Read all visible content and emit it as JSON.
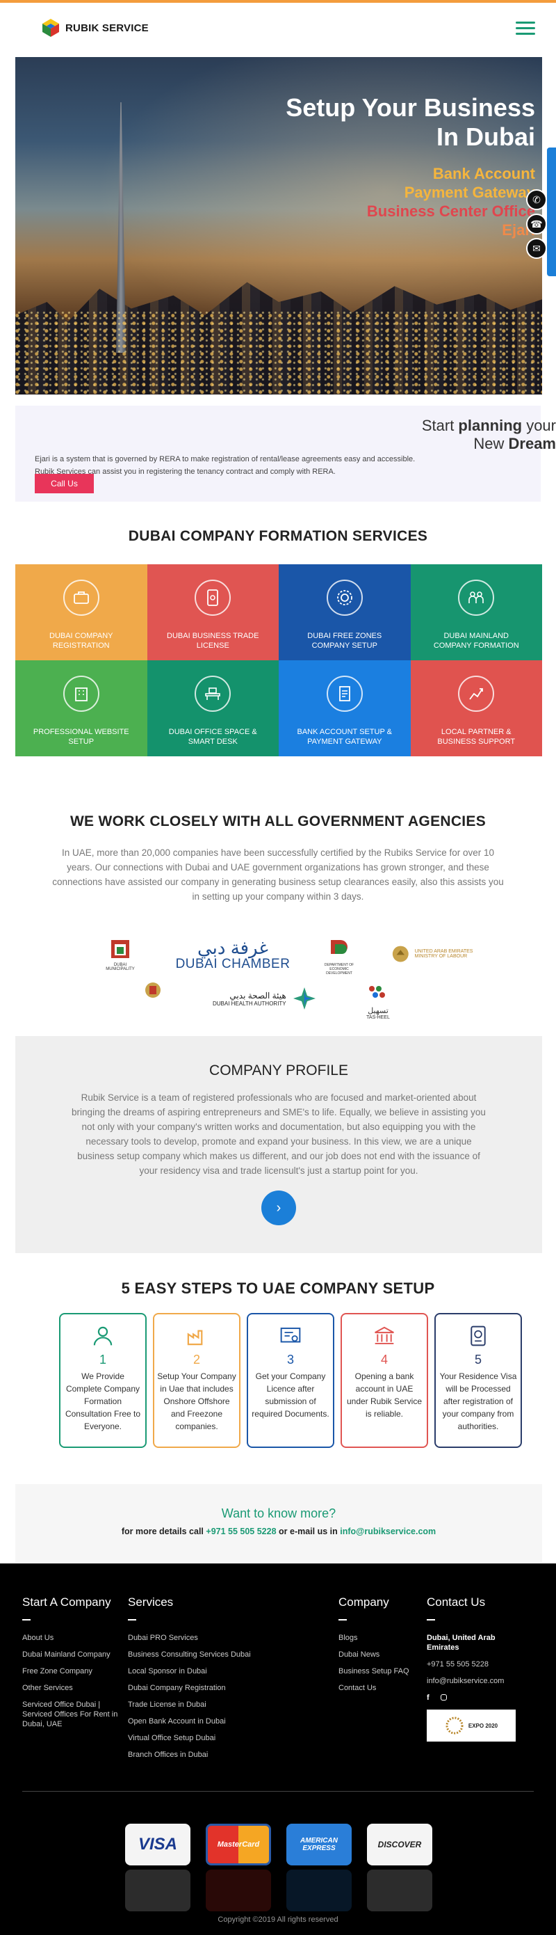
{
  "brand": {
    "name": "RUBIK SERVICE"
  },
  "hero": {
    "title_line1": "Setup Your Business",
    "title_line2": "In Dubai",
    "subs": [
      "Bank Account",
      "Payment Gateway",
      "Business Center Office",
      "Ejari"
    ]
  },
  "floating": {
    "whatsapp": "whatsapp-icon",
    "phone": "phone-icon",
    "mail": "mail-icon"
  },
  "ejari": {
    "head_pre": "Start ",
    "head_bold1": "planning",
    "head_post": " your",
    "head_pre2": "New ",
    "head_bold2": "Dream",
    "text1": "Ejari is a system that is governed by RERA to make registration of rental/lease agreements easy and accessible.",
    "text2": "Rubik Services can assist you in registering the tenancy contract and comply with RERA.",
    "button": "Call Us"
  },
  "services": {
    "title": "DUBAI COMPANY FORMATION SERVICES",
    "tiles": [
      {
        "label": "DUBAI COMPANY REGISTRATION",
        "icon": "briefcase-icon",
        "color": "#f0a94a"
      },
      {
        "label": "DUBAI BUSINESS TRADE LICENSE",
        "icon": "license-icon",
        "color": "#e05552"
      },
      {
        "label": "DUBAI FREE ZONES COMPANY SETUP",
        "icon": "gear-icon",
        "color": "#1a56a8"
      },
      {
        "label": "DUBAI MAINLAND COMPANY FORMATION",
        "icon": "people-icon",
        "color": "#17956f"
      },
      {
        "label": "PROFESSIONAL WEBSITE SETUP",
        "icon": "building-icon",
        "color": "#4cb050"
      },
      {
        "label": "DUBAI OFFICE SPACE & SMART DESK",
        "icon": "desk-icon",
        "color": "#14926c"
      },
      {
        "label": "BANK ACCOUNT SETUP & PAYMENT GATEWAY",
        "icon": "document-icon",
        "color": "#1b7fe0"
      },
      {
        "label": "LOCAL PARTNER & BUSINESS SUPPORT",
        "icon": "chart-icon",
        "color": "#e0534f"
      }
    ]
  },
  "government": {
    "title": "WE WORK CLOSELY WITH ALL GOVERNMENT AGENCIES",
    "text": "In UAE, more than 20,000 companies have been successfully certified by the Rubiks Service for over 10 years. Our connections with Dubai and UAE government organizations has grown stronger, and these connections have assisted our company in generating business setup clearances easily, also this assists you in setting up your company within 3 days.",
    "logos": {
      "municipality": "DUBAI MUNICIPALITY",
      "chamber_ar": "غرفة دبي",
      "chamber_en": "DUBAI CHAMBER",
      "ded": "DEPARTMENT OF ECONOMIC DEVELOPMENT",
      "labour": "UNITED ARAB EMIRATES MINISTRY OF LABOUR",
      "dha_ar": "هيئة الصحة بدبي",
      "dha_en": "DUBAI HEALTH AUTHORITY",
      "tasheel_ar": "تسهيل",
      "tasheel_en": "TAS-HEEL"
    }
  },
  "profile": {
    "title": "COMPANY PROFILE",
    "text": "Rubik Service is a team of registered professionals who are focused and market-oriented about bringing the dreams of aspiring entrepreneurs and SME's to life. Equally, we believe in assisting you not only with your company's written works and documentation, but also equipping you with the necessary tools to develop, promote and expand your business. In this view, we are a unique business setup company which makes us different, and our job does not end with the issuance of your residency visa and trade licensult's just a startup point for you.",
    "button_icon": "chevron-right-icon"
  },
  "steps": {
    "title_num": "5",
    "title_mid": " EASY STEPS TO ",
    "title_bold": "UAE COMPANY SETUP",
    "items": [
      {
        "num": "1",
        "text": "We Provide Complete Company Formation Consultation Free to Everyone.",
        "color": "#1a9a74",
        "icon": "user-icon"
      },
      {
        "num": "2",
        "text": "Setup Your Company in Uae that includes Onshore Offshore and Freezone companies.",
        "color": "#f0a94a",
        "icon": "factory-icon"
      },
      {
        "num": "3",
        "text": "Get your Company Licence after submission of required Documents.",
        "color": "#1a56a8",
        "icon": "certificate-icon"
      },
      {
        "num": "4",
        "text": "Opening a bank account in UAE under Rubik Service is reliable.",
        "color": "#e05552",
        "icon": "bank-icon"
      },
      {
        "num": "5",
        "text": "Your Residence Visa will be Processed after registration of your company from authorities.",
        "color": "#2a3c6a",
        "icon": "passport-icon"
      }
    ]
  },
  "know": {
    "title": "Want to know more?",
    "pre": "for more details call ",
    "phone": "+971 55 505 5228",
    "mid": " or e-mail us in ",
    "email": "info@rubikservice.com"
  },
  "footer": {
    "start": {
      "title": "Start A Company",
      "items": [
        "About Us",
        "Dubai Mainland Company",
        "Free Zone Company",
        "Other Services",
        "Serviced Office Dubai | Serviced Offices For Rent in Dubai, UAE"
      ]
    },
    "services": {
      "title": "Services",
      "items": [
        "Dubai PRO Services",
        "Business Consulting Services Dubai",
        "Local Sponsor in Dubai",
        "Dubai Company Registration",
        "Trade License in Dubai",
        "Open Bank Account in Dubai",
        "Virtual Office Setup Dubai",
        "Branch Offices in Dubai"
      ]
    },
    "company": {
      "title": "Company",
      "items": [
        "Blogs",
        "Dubai News",
        "Business Setup FAQ",
        "Contact Us"
      ]
    },
    "contact": {
      "title": "Contact Us",
      "address": "Dubai, United Arab Emirates",
      "phone": "+971 55 505 5228",
      "email": "info@rubikservice.com",
      "expo": "EXPO 2020"
    },
    "cards": [
      "VISA",
      "MasterCard",
      "AMERICAN EXPRESS",
      "DISCOVER"
    ],
    "copyright": "Copyright ©2019 All rights reserved"
  }
}
